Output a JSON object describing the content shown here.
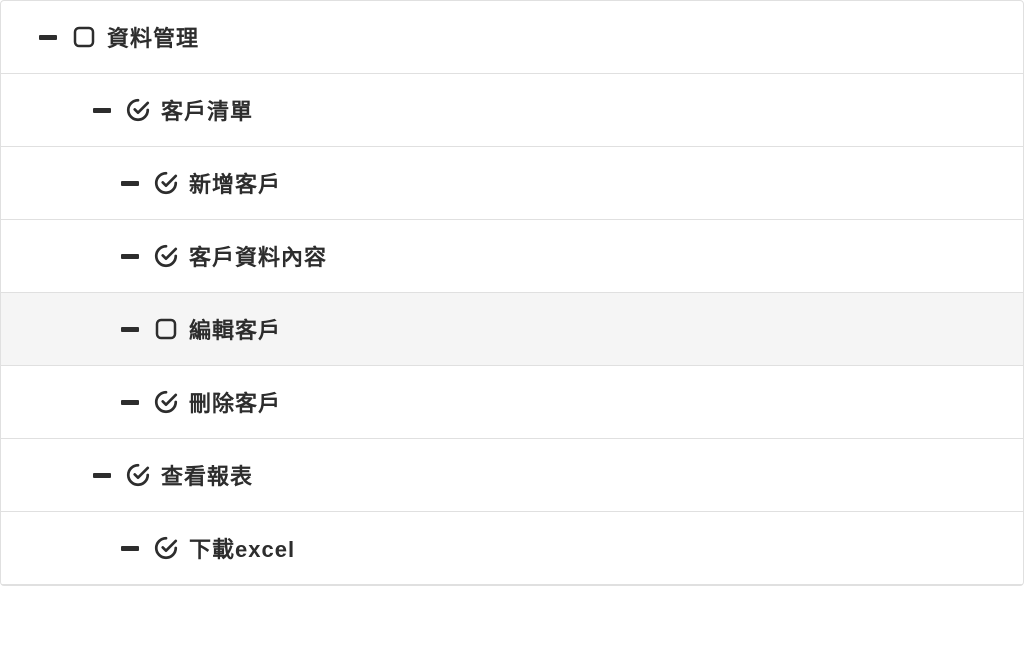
{
  "tree": {
    "items": [
      {
        "id": "data-management",
        "level": 0,
        "checked": false,
        "highlighted": false,
        "label": "資料管理"
      },
      {
        "id": "customer-list",
        "level": 1,
        "checked": true,
        "highlighted": false,
        "label": "客戶清單"
      },
      {
        "id": "add-customer",
        "level": 2,
        "checked": true,
        "highlighted": false,
        "label": "新增客戶"
      },
      {
        "id": "customer-details",
        "level": 2,
        "checked": true,
        "highlighted": false,
        "label": "客戶資料內容"
      },
      {
        "id": "edit-customer",
        "level": 2,
        "checked": false,
        "highlighted": true,
        "label": "編輯客戶"
      },
      {
        "id": "delete-customer",
        "level": 2,
        "checked": true,
        "highlighted": false,
        "label": "刪除客戶"
      },
      {
        "id": "view-reports",
        "level": 1,
        "checked": true,
        "highlighted": false,
        "label": "查看報表"
      },
      {
        "id": "download-excel",
        "level": 2,
        "checked": true,
        "highlighted": false,
        "label": "下載excel"
      }
    ]
  }
}
